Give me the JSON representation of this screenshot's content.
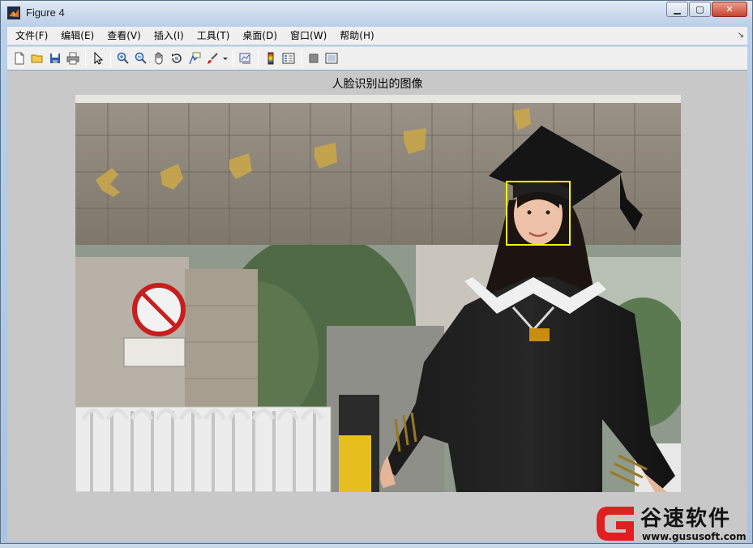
{
  "window": {
    "title": "Figure 4",
    "minimize_label": "▁",
    "maximize_label": "▢",
    "close_label": "✕"
  },
  "menubar": {
    "items": [
      {
        "label": "文件(F)"
      },
      {
        "label": "编辑(E)"
      },
      {
        "label": "查看(V)"
      },
      {
        "label": "插入(I)"
      },
      {
        "label": "工具(T)"
      },
      {
        "label": "桌面(D)"
      },
      {
        "label": "窗口(W)"
      },
      {
        "label": "帮助(H)"
      }
    ],
    "overflow_glyph": "↘"
  },
  "toolbar": {
    "icons": [
      "new-figure-icon",
      "open-file-icon",
      "save-icon",
      "print-icon",
      "pointer-icon",
      "zoom-in-icon",
      "zoom-out-icon",
      "pan-hand-icon",
      "rotate-3d-icon",
      "data-cursor-icon",
      "brush-icon",
      "link-plot-icon",
      "colorbar-icon",
      "legend-icon",
      "hide-plot-tools-icon",
      "show-plot-tools-icon"
    ]
  },
  "figure": {
    "title": "人脸识别出的图像",
    "face_box_color": "#ffff00"
  },
  "watermark": {
    "brand": "谷速软件",
    "url": "www.gususoft.com",
    "logo_color": "#e02020"
  }
}
